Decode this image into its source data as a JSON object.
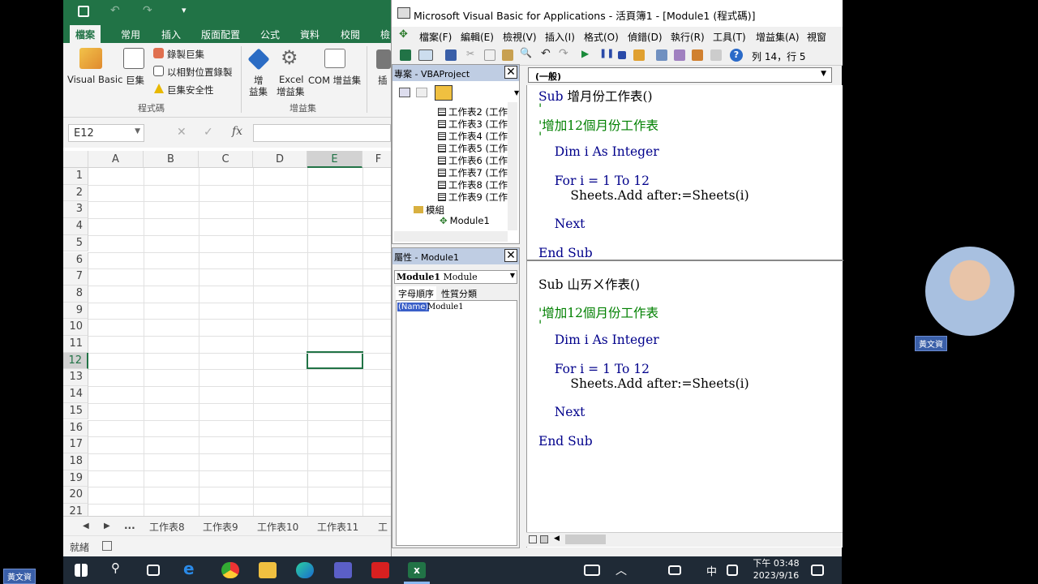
{
  "excel": {
    "tabs": [
      "檔案",
      "常用",
      "插入",
      "版面配置",
      "公式",
      "資料",
      "校閱",
      "檢"
    ],
    "ribbon": {
      "visual_basic": "Visual Basic",
      "macros": "巨集",
      "record_macro": "錄製巨集",
      "relative_ref": "以相對位置錄製",
      "macro_security": "巨集安全性",
      "addins_label_1": "增",
      "addins_label_2": "益集",
      "excel_addins_1": "Excel",
      "excel_addins_2": "增益集",
      "com_addins": "COM 增益集",
      "insert": "插",
      "group_code": "程式碼",
      "group_addins": "增益集"
    },
    "name_box": "E12",
    "columns": [
      "A",
      "B",
      "C",
      "D",
      "E",
      "F"
    ],
    "rows": [
      "1",
      "2",
      "3",
      "4",
      "5",
      "6",
      "7",
      "8",
      "9",
      "10",
      "11",
      "12",
      "13",
      "14",
      "15",
      "16",
      "17",
      "18",
      "19",
      "20",
      "21"
    ],
    "sheet_tabs": [
      "工作表8",
      "工作表9",
      "工作表10",
      "工作表11",
      "工"
    ],
    "ellipsis": "...",
    "status": "就緒"
  },
  "vbe": {
    "title": "Microsoft Visual Basic for Applications - 活頁簿1 - [Module1 (程式碼)]",
    "menu": [
      "檔案(F)",
      "編輯(E)",
      "檢視(V)",
      "插入(I)",
      "格式(O)",
      "偵錯(D)",
      "執行(R)",
      "工具(T)",
      "增益集(A)",
      "視窗(W)"
    ],
    "cursor_pos": "列 14，行 5",
    "project_title": "專案 - VBAProject",
    "tree": [
      "工作表2 (工作",
      "工作表3 (工作",
      "工作表4 (工作",
      "工作表5 (工作",
      "工作表6 (工作",
      "工作表7 (工作",
      "工作表8 (工作",
      "工作表9 (工作"
    ],
    "modules_folder": "模組",
    "module1": "Module1",
    "props_title": "屬性 - Module1",
    "props_combo_name": "Module1",
    "props_combo_type": "Module",
    "props_tab_alpha": "字母順序",
    "props_tab_cat": "性質分類",
    "prop_name_key": "(Name)",
    "prop_name_val": "Module1",
    "code_combo": "(一般)",
    "code": {
      "sub1": "Sub 增月份工作表()",
      "tick1": "'",
      "comment1": "'增加12個月份工作表",
      "tick1b": "'",
      "dim1": "    Dim i As Integer",
      "for1": "    For i = 1 To 12",
      "add1": "        Sheets.Add after:=Sheets(i)",
      "next1": "    Next",
      "end1": "End Sub",
      "sub2": "Sub 山ㄞㄨ作表()",
      "comment2": "'增加12個月份工作表",
      "tick2": "'",
      "dim2": "    Dim i As Integer",
      "for2": "    For i = 1 To 12",
      "add2": "        Sheets.Add after:=Sheets(i)",
      "next2": "    Next",
      "end2": "End Sub"
    }
  },
  "taskbar": {
    "ime": "中",
    "time": "下午 03:48",
    "date": "2023/9/16"
  },
  "webcam": {
    "name": "黃文資"
  },
  "corner_name": "黃文資"
}
